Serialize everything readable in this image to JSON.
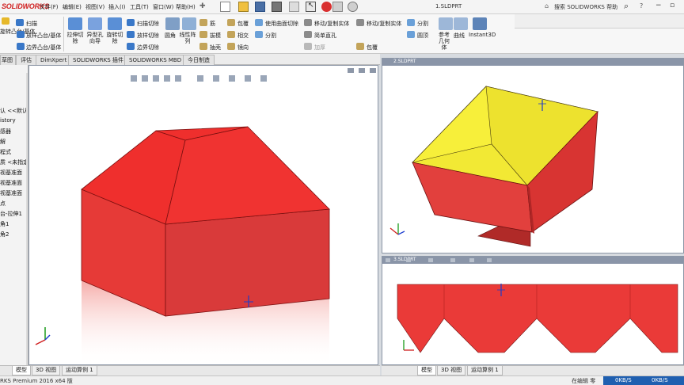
{
  "app": {
    "logo": "SOLIDWORKS",
    "logo_prefix": "3S"
  },
  "menu": [
    "文件(F)",
    "编辑(E)",
    "视图(V)",
    "插入(I)",
    "工具(T)",
    "窗口(W)",
    "帮助(H)"
  ],
  "document_title": "1.SLDPRT",
  "help_search": {
    "label": "搜索 SOLIDWORKS 帮助"
  },
  "ribbon": {
    "left_clip": [
      "旋转凸台/基体",
      "扫描",
      "放样凸台/基体",
      "边界凸台/基体"
    ],
    "big": [
      "拉伸切除",
      "异型孔向导",
      "旋转切除"
    ],
    "col_cut": [
      "扫描切除",
      "放样切除",
      "边界切除"
    ],
    "col_fillet": [
      "圆角",
      "线性阵列"
    ],
    "col_rib": [
      "筋",
      "拔模",
      "抽壳"
    ],
    "col_wrap": [
      "包覆",
      "相交",
      "镜向"
    ],
    "col_curve": [
      "使用曲面切除",
      "分割"
    ],
    "col_move": [
      "移动/复制实体",
      "简单直孔",
      "加厚"
    ],
    "col_move2": [
      "移动/复制实体",
      "包覆"
    ],
    "col_ref": [
      "分割",
      "圆顶"
    ],
    "col_geom": [
      "参考几何体",
      "曲线"
    ],
    "instant3d": "Instant3D"
  },
  "command_tabs": [
    "草图",
    "评估",
    "DimXpert",
    "SOLIDWORKS 插件",
    "SOLIDWORKS MBD",
    "今日制造"
  ],
  "feature_tree": [
    "认 <<默认",
    "istory",
    "感器",
    "解",
    "程式",
    "质 <未指定",
    "视基准面",
    "视基准面",
    "视基准面",
    "点",
    "台-拉伸1",
    "角1",
    "角2"
  ],
  "viewports": {
    "main": {
      "title": ""
    },
    "top_right": {
      "title": "2.SLDPRT"
    },
    "bottom_right": {
      "title": "3.SLDPRT"
    }
  },
  "bottom_tabs_left": [
    "模型",
    "3D 视图",
    "运动算例 1"
  ],
  "bottom_tabs_right": [
    "模型",
    "3D 视图",
    "运动算例 1"
  ],
  "status": {
    "left": "RKS Premium 2016 x64 版",
    "right1": "在编辑 零",
    "net1": "0KB/S",
    "net2": "0KB/S"
  },
  "colors": {
    "part_red": "#e8312e",
    "part_yellow": "#f7ef3a",
    "viewport_bg": "#ffffff",
    "titlebar_blue": "#2b4d7e"
  }
}
